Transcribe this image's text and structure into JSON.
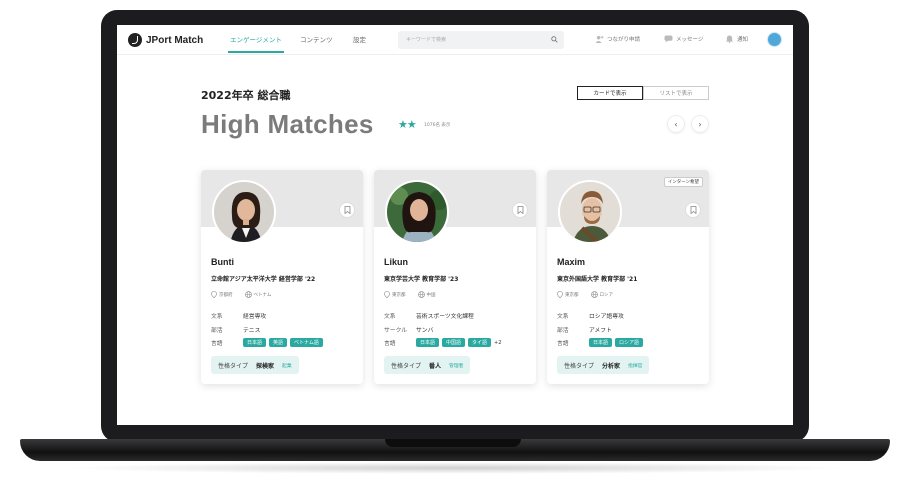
{
  "app": {
    "logo_text": "JPort Match"
  },
  "nav": {
    "items": [
      "エンゲージメント",
      "コンテンツ",
      "設定"
    ],
    "active_index": 0
  },
  "search": {
    "placeholder": "キーワードで検索"
  },
  "right_nav": {
    "connect": "つながり申請",
    "message": "メッセージ",
    "notify": "通知"
  },
  "heading": {
    "year": "2022年卒  総合職",
    "title": "High Matches",
    "stars": "★★",
    "count": "1076名 表示"
  },
  "view_toggle": {
    "card": "カードで表示",
    "list": "リストで表示",
    "selected": "card"
  },
  "pager": {
    "prev": "‹",
    "next": "›"
  },
  "colors": {
    "accent": "#2aa9a0",
    "avatar": "#4fa8d8"
  },
  "cards": [
    {
      "name": "Bunti",
      "university": "立命館アジア太平洋大学  経営学部  '22",
      "location": "京都府",
      "country": "ベトナム",
      "rows": [
        {
          "k": "文系",
          "v": "経営専攻"
        },
        {
          "k": "部活",
          "v": "テニス"
        }
      ],
      "lang_label": "言語",
      "languages": [
        "日本語",
        "英語",
        "ベトナム語"
      ],
      "more": "",
      "ptype_label": "性格タイプ",
      "ptype": "探検家",
      "ptype_sub": "起業",
      "intern": ""
    },
    {
      "name": "Likun",
      "university": "東京学芸大学  教育学部  '23",
      "location": "東京都",
      "country": "中国",
      "rows": [
        {
          "k": "文系",
          "v": "芸術スポーツ文化課程"
        },
        {
          "k": "サークル",
          "v": "サンバ"
        }
      ],
      "lang_label": "言語",
      "languages": [
        "日本語",
        "中国語",
        "タイ語"
      ],
      "more": "+2",
      "ptype_label": "性格タイプ",
      "ptype": "番人",
      "ptype_sub": "管理者",
      "intern": ""
    },
    {
      "name": "Maxim",
      "university": "東京外国語大学  教育学部  '21",
      "location": "東京都",
      "country": "ロシア",
      "rows": [
        {
          "k": "文系",
          "v": "ロシア語専攻"
        },
        {
          "k": "部活",
          "v": "アメフト"
        }
      ],
      "lang_label": "言語",
      "languages": [
        "日本語",
        "ロシア語"
      ],
      "more": "",
      "ptype_label": "性格タイプ",
      "ptype": "分析家",
      "ptype_sub": "指揮官",
      "intern": "インターン希望"
    }
  ]
}
